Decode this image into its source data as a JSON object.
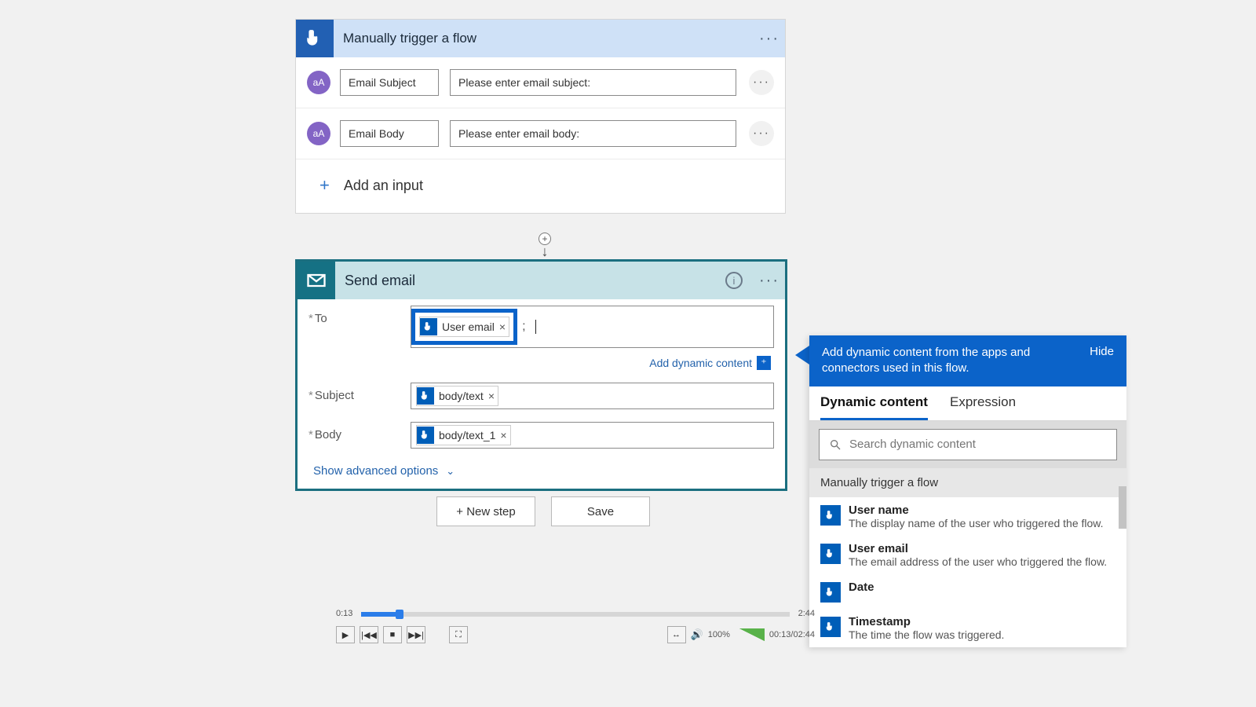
{
  "trigger": {
    "title": "Manually trigger a flow",
    "inputs": [
      {
        "name": "Email Subject",
        "prompt": "Please enter email subject:"
      },
      {
        "name": "Email Body",
        "prompt": "Please enter email body:"
      }
    ],
    "add_input": "Add an input"
  },
  "send": {
    "title": "Send email",
    "to_label": "To",
    "subject_label": "Subject",
    "body_label": "Body",
    "to_token": "User email",
    "subject_token": "body/text",
    "body_token": "body/text_1",
    "dyn_link": "Add dynamic content",
    "adv_link": "Show advanced options"
  },
  "buttons": {
    "new_step": "+ New step",
    "save": "Save"
  },
  "dyn": {
    "header": "Add dynamic content from the apps and connectors used in this flow.",
    "hide": "Hide",
    "tab_dc": "Dynamic content",
    "tab_expr": "Expression",
    "search_ph": "Search dynamic content",
    "section": "Manually trigger a flow",
    "items": [
      {
        "title": "User name",
        "desc": "The display name of the user who triggered the flow."
      },
      {
        "title": "User email",
        "desc": "The email address of the user who triggered the flow."
      },
      {
        "title": "Date",
        "desc": ""
      },
      {
        "title": "Timestamp",
        "desc": "The time the flow was triggered."
      }
    ]
  },
  "player": {
    "elapsed_short": "0:13",
    "total_short": "2:44",
    "elapsed": "00:13",
    "total": "02:44",
    "zoom": "100%"
  }
}
